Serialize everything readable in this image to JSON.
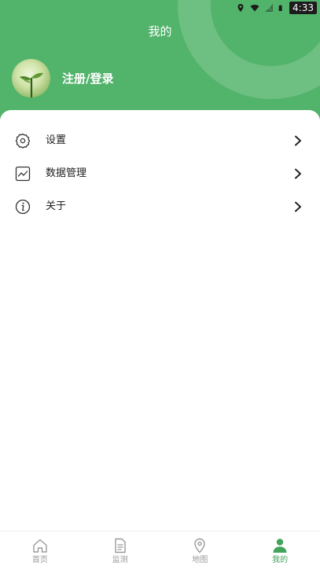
{
  "status_bar": {
    "time": "4:33"
  },
  "header": {
    "title": "我的"
  },
  "user": {
    "login_label": "注册/登录"
  },
  "menu": {
    "items": [
      {
        "label": "设置",
        "icon": "settings-icon"
      },
      {
        "label": "数据管理",
        "icon": "chart-icon"
      },
      {
        "label": "关于",
        "icon": "info-icon"
      }
    ]
  },
  "bottom_nav": {
    "tabs": [
      {
        "label": "首页",
        "icon": "home-icon",
        "active": false
      },
      {
        "label": "监测",
        "icon": "document-icon",
        "active": false
      },
      {
        "label": "地图",
        "icon": "map-pin-icon",
        "active": false
      },
      {
        "label": "我的",
        "icon": "person-icon",
        "active": true
      }
    ]
  },
  "colors": {
    "primary_green": "#52b36b",
    "active_tab": "#42a35a",
    "inactive_tab": "#9a9a9a"
  }
}
